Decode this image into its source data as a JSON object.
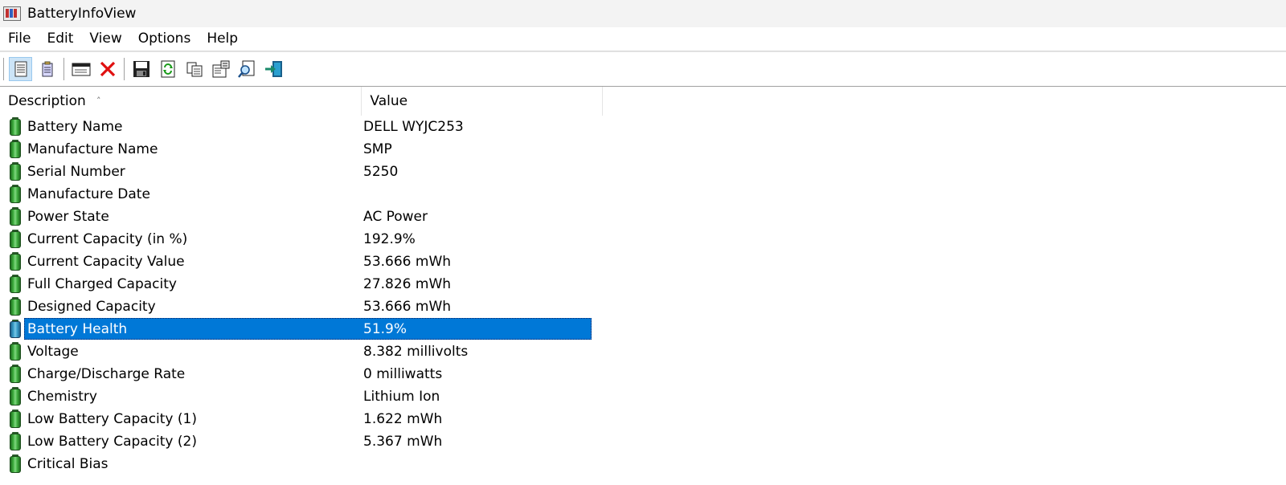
{
  "window": {
    "title": "BatteryInfoView"
  },
  "menu": [
    "File",
    "Edit",
    "View",
    "Options",
    "Help"
  ],
  "toolbar": {
    "buttons": [
      {
        "icon": "details-view-icon",
        "pressed": true
      },
      {
        "icon": "list-view-icon",
        "pressed": false
      },
      {
        "icon": "window-icon",
        "pressed": false
      },
      {
        "icon": "delete-x-icon",
        "pressed": false
      },
      {
        "icon": "save-disk-icon",
        "pressed": false
      },
      {
        "icon": "refresh-icon",
        "pressed": false
      },
      {
        "icon": "copy-icon",
        "pressed": false
      },
      {
        "icon": "properties-icon",
        "pressed": false
      },
      {
        "icon": "find-icon",
        "pressed": false
      },
      {
        "icon": "exit-icon",
        "pressed": false
      }
    ]
  },
  "columns": {
    "description": "Description",
    "value": "Value"
  },
  "rows": [
    {
      "description": "Battery Name",
      "value": "DELL WYJC253"
    },
    {
      "description": "Manufacture Name",
      "value": "SMP"
    },
    {
      "description": "Serial Number",
      "value": "5250"
    },
    {
      "description": "Manufacture Date",
      "value": ""
    },
    {
      "description": "Power State",
      "value": "AC Power"
    },
    {
      "description": "Current Capacity (in %)",
      "value": "192.9%"
    },
    {
      "description": "Current Capacity Value",
      "value": "53.666 mWh"
    },
    {
      "description": "Full Charged Capacity",
      "value": "27.826 mWh"
    },
    {
      "description": "Designed Capacity",
      "value": "53.666 mWh"
    },
    {
      "description": "Battery Health",
      "value": "51.9%",
      "selected": true
    },
    {
      "description": "Voltage",
      "value": "8.382 millivolts"
    },
    {
      "description": "Charge/Discharge Rate",
      "value": "0 milliwatts"
    },
    {
      "description": "Chemistry",
      "value": "Lithium Ion"
    },
    {
      "description": "Low Battery Capacity (1)",
      "value": "1.622 mWh"
    },
    {
      "description": "Low Battery Capacity (2)",
      "value": "5.367 mWh"
    },
    {
      "description": "Critical Bias",
      "value": ""
    }
  ],
  "colors": {
    "selection": "#0078d7",
    "battery_icon": "#3fae3f"
  }
}
